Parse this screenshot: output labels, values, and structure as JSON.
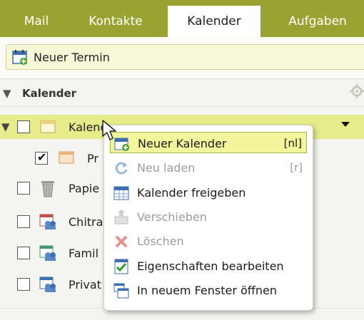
{
  "tabs": [
    {
      "label": "Mail",
      "active": false
    },
    {
      "label": "Kontakte",
      "active": false
    },
    {
      "label": "Kalender",
      "active": true
    },
    {
      "label": "Aufgaben",
      "active": false
    }
  ],
  "toolbar": {
    "new_event_label": "Neuer Termin"
  },
  "section": {
    "title": "Kalender"
  },
  "calendars": [
    {
      "label": "Kalender",
      "checked": false,
      "selected": true
    },
    {
      "label": "Pr",
      "checked": true,
      "selected": false
    },
    {
      "label": "Papie",
      "checked": false,
      "selected": false
    },
    {
      "label": "Chitra",
      "checked": false,
      "selected": false
    },
    {
      "label": "Famil",
      "checked": false,
      "selected": false
    },
    {
      "label": "Privat",
      "checked": false,
      "selected": false
    }
  ],
  "context_menu": [
    {
      "label": "Neuer Kalender",
      "shortcut": "[nl]",
      "enabled": true,
      "highlighted": true,
      "icon": "new-calendar-icon"
    },
    {
      "label": "Neu laden",
      "shortcut": "[r]",
      "enabled": false,
      "highlighted": false,
      "icon": "reload-icon"
    },
    {
      "label": "Kalender freigeben",
      "shortcut": "",
      "enabled": true,
      "highlighted": false,
      "icon": "share-calendar-icon"
    },
    {
      "label": "Verschieben",
      "shortcut": "",
      "enabled": false,
      "highlighted": false,
      "icon": "move-icon"
    },
    {
      "label": "Löschen",
      "shortcut": "",
      "enabled": false,
      "highlighted": false,
      "icon": "delete-icon"
    },
    {
      "label": "Eigenschaften bearbeiten",
      "shortcut": "",
      "enabled": true,
      "highlighted": false,
      "icon": "properties-icon"
    },
    {
      "label": "In neuem Fenster öffnen",
      "shortcut": "",
      "enabled": true,
      "highlighted": false,
      "icon": "new-window-icon"
    }
  ],
  "colors": {
    "accent": "#9aa332",
    "selection": "#e6ec8a",
    "menu_highlight": "#f3f59c"
  }
}
